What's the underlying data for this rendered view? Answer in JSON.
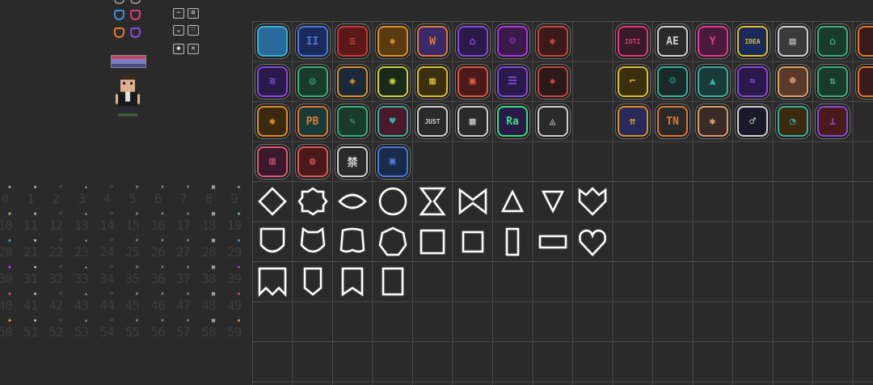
{
  "palette": {
    "background": "#2a2a2a",
    "grid_line": "#4a4a4a",
    "outline": "#ffffff",
    "dim_number": "#3c3c3c"
  },
  "shield_swatches": [
    {
      "color": "#8a8a8a",
      "style": "half"
    },
    {
      "color": "#8a8a8a",
      "style": "half"
    },
    {
      "color": "#3a8fd6",
      "style": "full"
    },
    {
      "color": "#e23a7a",
      "style": "full"
    },
    {
      "color": "#e07a2a",
      "style": "full"
    },
    {
      "color": "#8a4ae0",
      "style": "full"
    }
  ],
  "mini_buttons": [
    {
      "icon": "minus-icon",
      "glyph": "−"
    },
    {
      "icon": "list-icon",
      "glyph": "≡"
    },
    {
      "icon": "chevron-down-icon",
      "glyph": "⌄"
    },
    {
      "icon": "heart-icon",
      "glyph": "♡"
    },
    {
      "icon": "diamond-icon",
      "glyph": "◆"
    },
    {
      "icon": "cross-icon",
      "glyph": "✕"
    }
  ],
  "color_bars": [
    "#c84a6a",
    "#7a7ad6",
    "#4a4a8a"
  ],
  "number_grid": {
    "rows": [
      {
        "dot_color": "#9a9a9a",
        "numbers": [
          "0",
          "1",
          "2",
          "3",
          "4",
          "5",
          "6",
          "7",
          "8",
          "9"
        ]
      },
      {
        "dot_color": "#7ac24a",
        "numbers": [
          "10",
          "11",
          "12",
          "13",
          "14",
          "15",
          "16",
          "17",
          "18",
          "19"
        ]
      },
      {
        "dot_color": "#3a9ad6",
        "numbers": [
          "20",
          "21",
          "22",
          "23",
          "24",
          "25",
          "26",
          "27",
          "28",
          "29"
        ]
      },
      {
        "dot_color": "#b03ae0",
        "numbers": [
          "30",
          "31",
          "32",
          "33",
          "34",
          "35",
          "36",
          "37",
          "38",
          "39"
        ]
      },
      {
        "dot_color": "#e23a7a",
        "numbers": [
          "40",
          "41",
          "42",
          "43",
          "44",
          "45",
          "46",
          "47",
          "48",
          "49"
        ]
      },
      {
        "dot_color": "#e0902a",
        "numbers": [
          "50",
          "51",
          "52",
          "53",
          "54",
          "55",
          "56",
          "57",
          "58",
          "59"
        ]
      }
    ],
    "row_marks": [
      "◆",
      "▪",
      "⁘",
      "▴",
      "⁘",
      "✕",
      "✕",
      "✕",
      "▦",
      "▪"
    ]
  },
  "badges": [
    {
      "label": "",
      "icon": "cycle-badge-icon",
      "color": "#3ab0d6",
      "fill": "#2a6a9a"
    },
    {
      "label": "II",
      "icon": "gate-badge-icon",
      "color": "#4a7ae0",
      "fill": "#1a2a5a"
    },
    {
      "label": "≡",
      "icon": "scroll-badge-icon",
      "color": "#c83a3a",
      "fill": "#5a1a1a"
    },
    {
      "label": "✺",
      "icon": "flower-badge-icon",
      "color": "#e0902a",
      "fill": "#5a3a10"
    },
    {
      "label": "W",
      "icon": "wings-badge-icon",
      "color": "#e07a3a",
      "fill": "#3a2a6a"
    },
    {
      "label": "⌂",
      "icon": "temple-badge-icon",
      "color": "#8a4ae0",
      "fill": "#2a1a4a"
    },
    {
      "label": "☺",
      "icon": "mask-badge-icon",
      "color": "#b03ae0",
      "fill": "#3a1a4a"
    },
    {
      "label": "✱",
      "icon": "gear-badge-icon",
      "color": "#c84a3a",
      "fill": "#3a1a1a"
    },
    {
      "label": "",
      "icon": "empty-slot",
      "color": "",
      "fill": ""
    },
    {
      "label": "IOTI",
      "icon": "ioti-badge-icon",
      "color": "#e23a7a",
      "fill": "#3a1a2a"
    },
    {
      "label": "AE",
      "icon": "tag-badge-icon",
      "color": "#d0d0d0",
      "fill": "#2a2a2a"
    },
    {
      "label": "Y",
      "icon": "branch-badge-icon",
      "color": "#e23a9a",
      "fill": "#4a1a3a"
    },
    {
      "label": "IDEA",
      "icon": "idea-badge-icon",
      "color": "#e0c02a",
      "fill": "#1a2a5a"
    },
    {
      "label": "▤",
      "icon": "document-badge-icon",
      "color": "#d0d0d0",
      "fill": "#3a3a3a"
    },
    {
      "label": "⌂",
      "icon": "museum-badge-icon",
      "color": "#3ab07a",
      "fill": "#1a3a2a"
    },
    {
      "label": "",
      "icon": "partial-badge-icon",
      "color": "#e07a2a",
      "fill": "#3a1a1a"
    },
    {
      "label": "≋",
      "icon": "dna-badge-icon",
      "color": "#8a4ae0",
      "fill": "#2a1a4a"
    },
    {
      "label": "◎",
      "icon": "eye-badge-icon",
      "color": "#3ab07a",
      "fill": "#1a3a2a"
    },
    {
      "label": "◈",
      "icon": "crystal-badge-icon",
      "color": "#e0902a",
      "fill": "#1a2a3a"
    },
    {
      "label": "◉",
      "icon": "lens-badge-icon",
      "color": "#d0d03a",
      "fill": "#1a2a1a"
    },
    {
      "label": "▦",
      "icon": "chip-badge-icon",
      "color": "#e0c02a",
      "fill": "#3a3010"
    },
    {
      "label": "▣",
      "icon": "box-badge-icon",
      "color": "#e05a3a",
      "fill": "#4a1a1a"
    },
    {
      "label": "☰",
      "icon": "tablet-badge-icon",
      "color": "#8a4ae0",
      "fill": "#2a1a4a"
    },
    {
      "label": "✹",
      "icon": "burst-badge-icon",
      "color": "#c84a3a",
      "fill": "#2a1a1a"
    },
    {
      "label": "",
      "icon": "empty-slot",
      "color": "",
      "fill": ""
    },
    {
      "label": "⌐",
      "icon": "terminal-badge-icon",
      "color": "#e0c02a",
      "fill": "#3a3010"
    },
    {
      "label": "☺",
      "icon": "smile-badge-icon",
      "color": "#3ab0a0",
      "fill": "#1a2a2a"
    },
    {
      "label": "▲",
      "icon": "mountain-badge-icon",
      "color": "#3ab0a0",
      "fill": "#1a3a3a"
    },
    {
      "label": "≈",
      "icon": "wifi-badge-icon",
      "color": "#8a4ae0",
      "fill": "#2a1a4a"
    },
    {
      "label": "☻",
      "icon": "bear-badge-icon",
      "color": "#e0a06a",
      "fill": "#5a3a2a"
    },
    {
      "label": "⇅",
      "icon": "arrows-badge-icon",
      "color": "#3ab07a",
      "fill": "#1a3a2a"
    },
    {
      "label": "",
      "icon": "partial-badge-icon",
      "color": "#e07a2a",
      "fill": "#3a1a1a"
    },
    {
      "label": "✱",
      "icon": "sun-badge-icon",
      "color": "#e0902a",
      "fill": "#3a2a10"
    },
    {
      "label": "PB",
      "icon": "pb-badge-icon",
      "color": "#e07a2a",
      "fill": "#1a3a3a"
    },
    {
      "label": "✎",
      "icon": "leaf-badge-icon",
      "color": "#3ab07a",
      "fill": "#1a3a2a"
    },
    {
      "label": "♥",
      "icon": "heart-badge-icon",
      "color": "#3ab0a0",
      "fill": "#4a1a2a"
    },
    {
      "label": "JUST",
      "icon": "just-badge-icon",
      "color": "#d0d0d0",
      "fill": "#2a2a2a"
    },
    {
      "label": "▦",
      "icon": "grid-badge-icon",
      "color": "#d0d0d0",
      "fill": "#2a2a2a"
    },
    {
      "label": "Ra",
      "icon": "ra-badge-icon",
      "color": "#3ae07a",
      "fill": "#2a1a4a"
    },
    {
      "label": "◬",
      "icon": "triangle-eye-badge-icon",
      "color": "#d0d0d0",
      "fill": "#2a2a2a"
    },
    {
      "label": "",
      "icon": "empty-slot",
      "color": "",
      "fill": ""
    },
    {
      "label": "⇈",
      "icon": "up-arrows-badge-icon",
      "color": "#e0902a",
      "fill": "#2a2a5a"
    },
    {
      "label": "TN",
      "icon": "tn-badge-icon",
      "color": "#e07a2a",
      "fill": "#2a2a2a"
    },
    {
      "label": "✱",
      "icon": "star-badge-icon",
      "color": "#e0a06a",
      "fill": "#3a2a2a"
    },
    {
      "label": "♂",
      "icon": "ring-badge-icon",
      "color": "#d0d0d0",
      "fill": "#1a1a2a"
    },
    {
      "label": "◔",
      "icon": "orb-badge-icon",
      "color": "#3ab0a0",
      "fill": "#3a2a10"
    },
    {
      "label": "⊥",
      "icon": "joystick-badge-icon",
      "color": "#8a4ae0",
      "fill": "#4a1a1a"
    },
    {
      "label": "",
      "icon": "empty-slot",
      "color": "",
      "fill": ""
    },
    {
      "label": "▥",
      "icon": "pillar-badge-icon",
      "color": "#e05a7a",
      "fill": "#3a1a2a"
    },
    {
      "label": "◍",
      "icon": "pennant-badge-icon",
      "color": "#e05a5a",
      "fill": "#4a1a1a"
    },
    {
      "label": "禁",
      "icon": "glyph-badge-icon",
      "color": "#d0d0d0",
      "fill": "#2a2a2a"
    },
    {
      "label": "▣",
      "icon": "banner-badge-icon",
      "color": "#4a7ae0",
      "fill": "#1a2a4a"
    }
  ],
  "shapes": [
    {
      "shape": "diamond",
      "icon": "diamond-frame-icon"
    },
    {
      "shape": "gear",
      "icon": "gear-frame-icon"
    },
    {
      "shape": "lens",
      "icon": "lens-frame-icon"
    },
    {
      "shape": "circle",
      "icon": "circle-frame-icon"
    },
    {
      "shape": "hourglass",
      "icon": "hourglass-frame-icon"
    },
    {
      "shape": "bowtie",
      "icon": "bowtie-frame-icon"
    },
    {
      "shape": "triangle-up",
      "icon": "triangle-up-frame-icon"
    },
    {
      "shape": "triangle-down",
      "icon": "triangle-down-frame-icon"
    },
    {
      "shape": "crown-heart",
      "icon": "crown-heart-frame-icon"
    },
    {
      "shape": "shield",
      "icon": "shield-frame-icon"
    },
    {
      "shape": "notched-shield",
      "icon": "notched-shield-frame-icon"
    },
    {
      "shape": "scalloped",
      "icon": "scalloped-frame-icon"
    },
    {
      "shape": "heptagon",
      "icon": "heptagon-frame-icon"
    },
    {
      "shape": "square-lg",
      "icon": "square-large-frame-icon"
    },
    {
      "shape": "square-md",
      "icon": "square-medium-frame-icon"
    },
    {
      "shape": "rect-tall",
      "icon": "rect-tall-frame-icon"
    },
    {
      "shape": "rect-wide",
      "icon": "rect-wide-frame-icon"
    },
    {
      "shape": "heart",
      "icon": "heart-frame-icon"
    },
    {
      "shape": "banner-swallow",
      "icon": "banner-swallowtail-frame-icon"
    },
    {
      "shape": "banner-point",
      "icon": "banner-pointed-frame-icon"
    },
    {
      "shape": "banner-notch",
      "icon": "banner-notched-frame-icon"
    },
    {
      "shape": "tall-rect",
      "icon": "tall-rect-frame-icon"
    }
  ]
}
